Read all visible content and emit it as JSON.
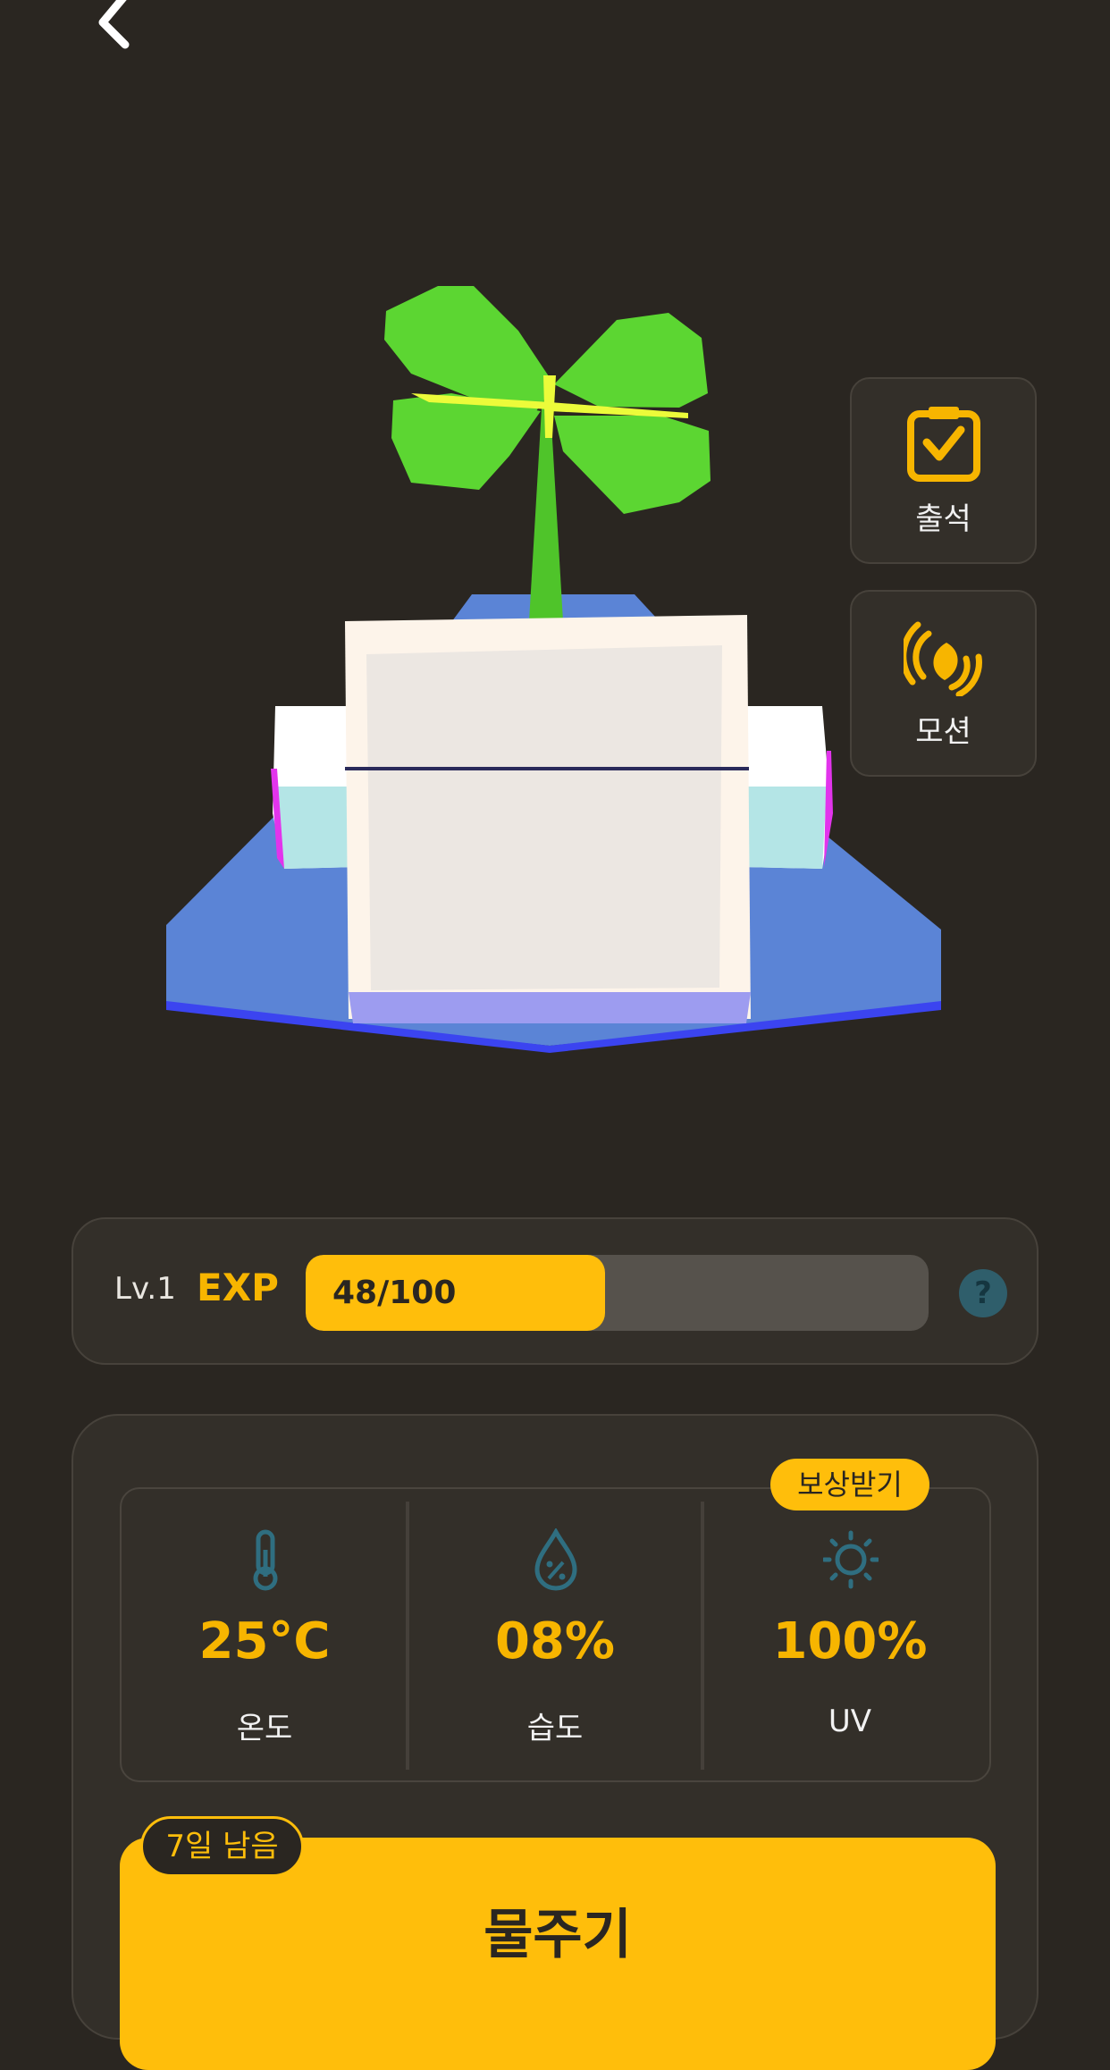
{
  "header": {
    "back_icon": "chevron-left-icon"
  },
  "side_buttons": {
    "attendance": {
      "label": "출석",
      "icon": "calendar-check-icon"
    },
    "motion": {
      "label": "모션",
      "icon": "vibration-leaf-icon"
    }
  },
  "exp": {
    "level": "Lv.1",
    "label": "EXP",
    "text": "48/100",
    "progress": 0.48,
    "help_icon": "question-icon",
    "help_text": "?"
  },
  "stats": {
    "temperature": {
      "value": "25°C",
      "label": "온도",
      "icon": "thermometer-icon"
    },
    "humidity": {
      "value": "08%",
      "label": "습도",
      "icon": "water-drop-percent-icon"
    },
    "uv": {
      "value": "100%",
      "label": "UV",
      "icon": "sun-icon"
    },
    "reward_badge": "보상받기"
  },
  "water": {
    "label": "물주기",
    "days_left": "7일 남음"
  },
  "colors": {
    "background": "#2a2621",
    "panel": "#332f29",
    "accent": "#ffbe0b",
    "leaf": "#5cd632",
    "pot_base": "#5b84d6"
  }
}
